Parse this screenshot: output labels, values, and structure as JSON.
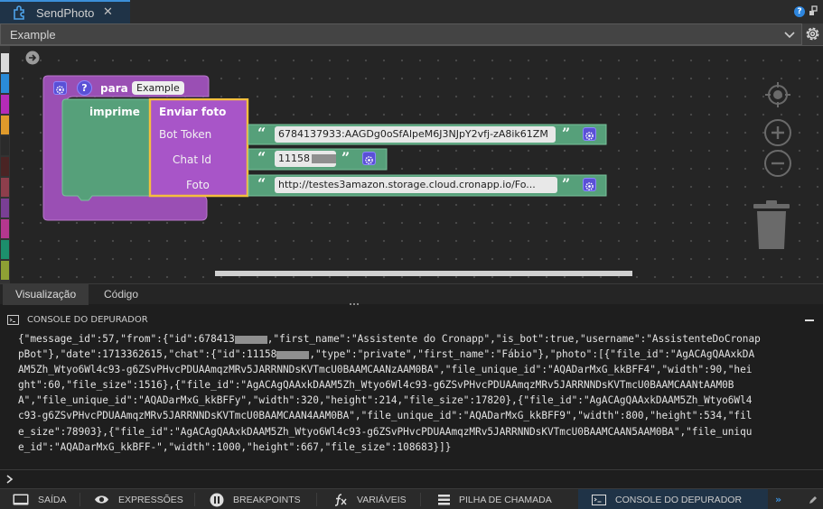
{
  "tab": {
    "title": "SendPhoto",
    "close": "✕"
  },
  "select": {
    "value": "Example"
  },
  "blocks": {
    "para": "para",
    "proc_name": "Example",
    "imprime": "imprime",
    "enviar_foto": "Enviar foto",
    "bot_token_label": "Bot Token",
    "bot_token_value": "6784137933:AAGDg0oSfAlpeM6J3NJpY2vfj-zA8ik61ZM",
    "chat_id_label": "Chat Id",
    "chat_id_value": "11158",
    "foto_label": "Foto",
    "foto_value": "http://testes3amazon.storage.cloud.cronapp.io/Fo..."
  },
  "view_tabs": [
    "Visualização",
    "Código"
  ],
  "console": {
    "title": "CONSOLE DO DEPURADOR",
    "lines": [
      "{\"message_id\":57,\"from\":{\"id\":678413",
      "pBot\"},\"date\":1713362615,\"chat\":{\"id\":11158",
      "AM5Zh_Wtyo6Wl4c93-g6ZSvPHvcPDUAAmqzMRv5JARRNNDsKVTmcU0BAAMCAANzAAM0BA\",\"file_unique_id\":\"AQADarMxG_kkBFF4\",\"width\":90,\"hei",
      "ght\":60,\"file_size\":1516},{\"file_id\":\"AgACAgQAAxkDAAM5Zh_Wtyo6Wl4c93-g6ZSvPHvcPDUAAmqzMRv5JARRNNDsKVTmcU0BAAMCAANtAAM0B",
      "A\",\"file_unique_id\":\"AQADarMxG_kkBFFy\",\"width\":320,\"height\":214,\"file_size\":17820},{\"file_id\":\"AgACAgQAAxkDAAM5Zh_Wtyo6Wl4",
      "c93-g6ZSvPHvcPDUAAmqzMRv5JARRNNDsKVTmcU0BAAMCAAN4AAM0BA\",\"file_unique_id\":\"AQADarMxG_kkBFF9\",\"width\":800,\"height\":534,\"fil",
      "e_size\":78903},{\"file_id\":\"AgACAgQAAxkDAAM5Zh_Wtyo6Wl4c93-g6ZSvPHvcPDUAAmqzMRv5JARRNNDsKVTmcU0BAAMCAAN5AAM0BA\",\"file_uniqu",
      "e_id\":\"AQADarMxG_kkBFF-\",\"width\":1000,\"height\":667,\"file_size\":108683}]}"
    ],
    "line0_rest": ",\"first_name\":\"Assistente do Cronapp\",\"is_bot\":true,\"username\":\"AssistenteDoCronap",
    "line1_rest": ",\"type\":\"private\",\"first_name\":\"Fábio\"},\"photo\":[{\"file_id\":\"AgACAgQAAxkDA"
  },
  "bottom": [
    "SAÍDA",
    "EXPRESSÕES",
    "BREAKPOINTS",
    "VARIÁVEIS",
    "PILHA DE CHAMADA",
    "CONSOLE DO DEPURADOR"
  ],
  "colors": {
    "procedure": "#9a4fb4",
    "text_block": "#56a07a",
    "custom": "#a855c8",
    "accent": "#3b8fd9"
  }
}
